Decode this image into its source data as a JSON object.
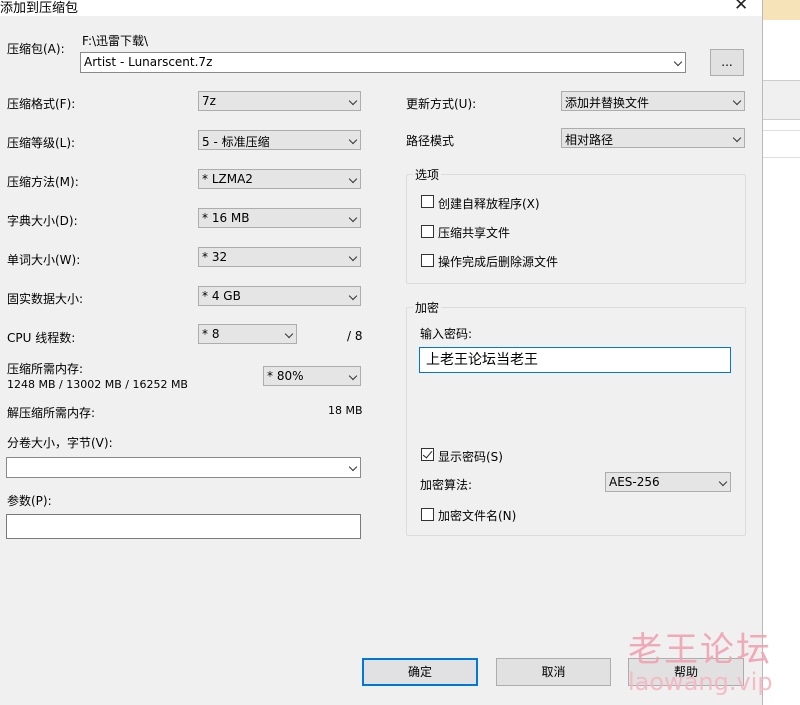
{
  "window": {
    "title": "添加到压缩包",
    "close_glyph": "✕"
  },
  "archive": {
    "label": "压缩包(A):",
    "path": "F:\\迅雷下载\\",
    "name": "Artist - Lunarscent.7z",
    "browse_label": "..."
  },
  "left": {
    "format": {
      "label": "压缩格式(F):",
      "value": "7z"
    },
    "level": {
      "label": "压缩等级(L):",
      "value": "5 - 标准压缩"
    },
    "method": {
      "label": "压缩方法(M):",
      "value": "* LZMA2"
    },
    "dict": {
      "label": "字典大小(D):",
      "value": "* 16 MB"
    },
    "word": {
      "label": "单词大小(W):",
      "value": "* 32"
    },
    "solid": {
      "label": "固实数据大小:",
      "value": "* 4 GB"
    },
    "cpu": {
      "label": "CPU 线程数:",
      "value": "* 8",
      "total": "/ 8"
    },
    "mem_comp": {
      "label": "压缩所需内存:",
      "detail": "1248 MB / 13002 MB / 16252 MB",
      "value": "* 80%"
    },
    "mem_decomp": {
      "label": "解压缩所需内存:",
      "value": "18 MB"
    },
    "split": {
      "label": "分卷大小，字节(V):",
      "value": ""
    },
    "params": {
      "label": "参数(P):",
      "value": ""
    }
  },
  "right": {
    "update": {
      "label": "更新方式(U):",
      "value": "添加并替换文件"
    },
    "path_mode": {
      "label": "路径模式",
      "value": "相对路径"
    },
    "options": {
      "title": "选项",
      "sfx": {
        "label": "创建自释放程序(X)",
        "checked": false
      },
      "shared": {
        "label": "压缩共享文件",
        "checked": false
      },
      "delete": {
        "label": "操作完成后删除源文件",
        "checked": false
      }
    },
    "encryption": {
      "title": "加密",
      "password_label": "输入密码:",
      "password_value": "上老王论坛当老王",
      "show_password": {
        "label": "显示密码(S)",
        "checked": true
      },
      "algo_label": "加密算法:",
      "algo_value": "AES-256",
      "encrypt_names": {
        "label": "加密文件名(N)",
        "checked": false
      }
    }
  },
  "buttons": {
    "ok": "确定",
    "cancel": "取消",
    "help": "帮助"
  },
  "watermark": {
    "cn": "老王论坛",
    "en": "laowang.vip"
  }
}
